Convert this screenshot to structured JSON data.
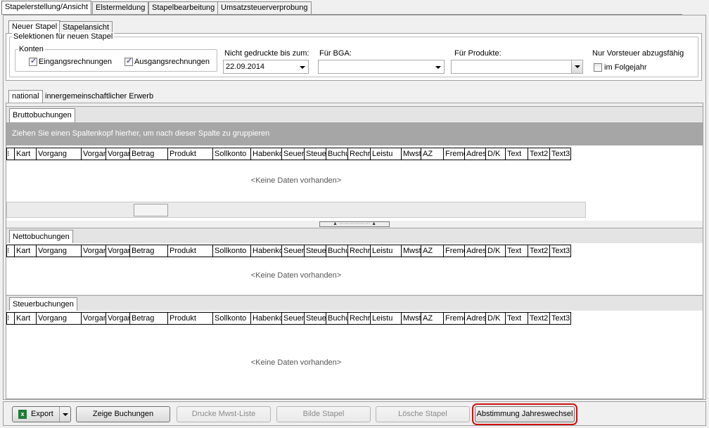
{
  "top_tabs": [
    "Stapelerstellung/Ansicht",
    "Elstermeldung",
    "Stapelbearbeitung",
    "Umsatzsteuerverprobung"
  ],
  "sub_tabs": [
    "Neuer Stapel",
    "Stapelansicht"
  ],
  "selection": {
    "title": "Selektionen für neuen Stapel",
    "konten_label": "Konten",
    "eingang_label": "Eingangsrechnungen",
    "eingang_checked": true,
    "ausgang_label": "Ausgangsrechnungen",
    "ausgang_checked": true,
    "nicht_gedruckt_label": "Nicht gedruckte bis zum:",
    "date_value": "22.09.2014",
    "bga_label": "Für BGA:",
    "bga_value": "",
    "produkte_label": "Für Produkte:",
    "produkte_value": "",
    "vorsteuer_label": "Nur Vorsteuer abzugsfähig",
    "folgejahr_label": "im Folgejahr",
    "folgejahr_checked": false
  },
  "national_tabs": [
    "national",
    "innergemeinschaftlicher Erwerb"
  ],
  "sections": {
    "brutto": "Bruttobuchungen",
    "netto": "Nettobuchungen",
    "steuer": "Steuerbuchungen"
  },
  "group_hint": "Ziehen Sie einen Spaltenkopf hierher, um nach dieser Spalte zu gruppieren",
  "columns": [
    "Kart",
    "Vorgang",
    "Vorgar",
    "Vorgar",
    "Betrag",
    "Produkt",
    "Sollkonto",
    "Habenkon",
    "Seuerts",
    "Steue",
    "Buchu",
    "Rechr",
    "Leistu",
    "Mwstdat",
    "AZ",
    "Fremc",
    "Adres",
    "D/K",
    "Text",
    "Text2",
    "Text3"
  ],
  "no_data": "<Keine Daten vorhanden>",
  "buttons": {
    "export": "Export",
    "zeige": "Zeige Buchungen",
    "drucke": "Drucke Mwst-Liste",
    "bilde": "Bilde Stapel",
    "loesche": "Lösche Stapel",
    "abstimmung": "Abstimmung Jahreswechsel"
  },
  "colors": {
    "highlight": "#d11010",
    "group_bar": "#a6a6a6"
  }
}
